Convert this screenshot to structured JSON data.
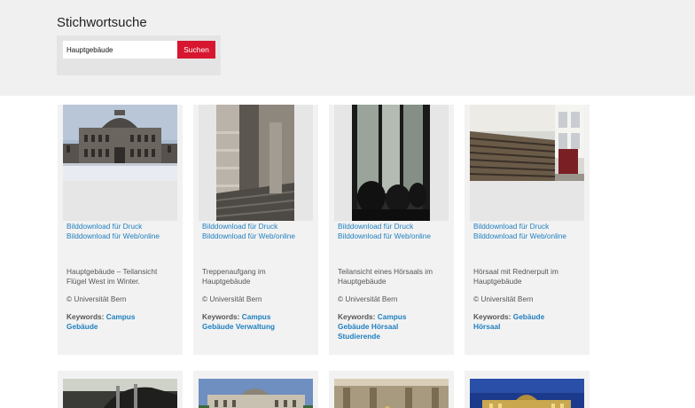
{
  "search": {
    "title": "Stichwortsuche",
    "value": "Hauptgebäude",
    "button_label": "Suchen"
  },
  "cards": [
    {
      "link_print": "Bilddownload für Druck",
      "link_web": "Bilddownload für Web/online",
      "description": "Hauptgebäude – Teilansicht Flügel West im Winter.",
      "copyright": "© Universität Bern",
      "keywords_label": "Keywords:",
      "keywords": [
        "Campus",
        "Gebäude"
      ]
    },
    {
      "link_print": "Bilddownload für Druck",
      "link_web": "Bilddownload für Web/online",
      "description": "Treppenaufgang im Hauptgebäude",
      "copyright": "© Universität Bern",
      "keywords_label": "Keywords:",
      "keywords": [
        "Campus",
        "Gebäude",
        "Verwaltung"
      ]
    },
    {
      "link_print": "Bilddownload für Druck",
      "link_web": "Bilddownload für Web/online",
      "description": "Teilansicht eines Hörsaals im Hauptgebäude",
      "copyright": "© Universität Bern",
      "keywords_label": "Keywords:",
      "keywords": [
        "Campus",
        "Gebäude",
        "Hörsaal",
        "Studierende"
      ]
    },
    {
      "link_print": "Bilddownload für Druck",
      "link_web": "Bilddownload für Web/online",
      "description": "Hörsaal mit Rednerpult im Hauptgebäude",
      "copyright": "© Universität Bern",
      "keywords_label": "Keywords:",
      "keywords": [
        "Gebäude",
        "Hörsaal"
      ]
    }
  ]
}
